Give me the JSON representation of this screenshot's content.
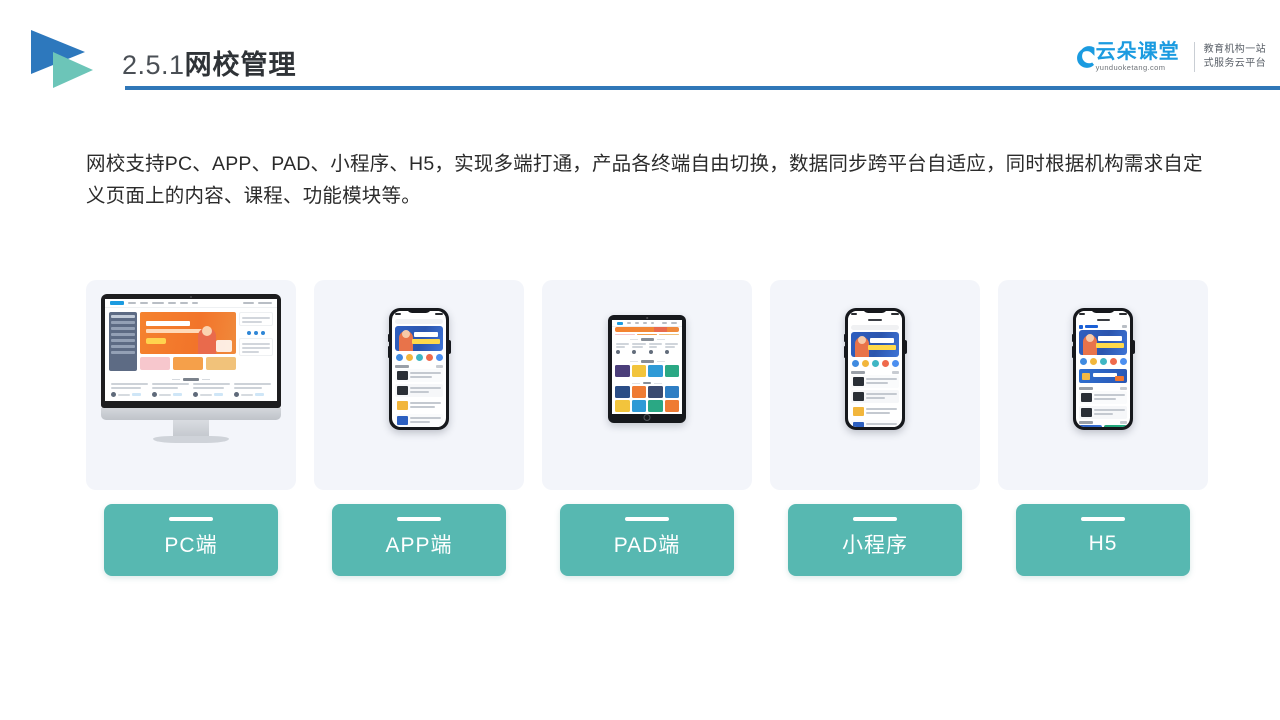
{
  "header": {
    "section_number": "2.5.1",
    "section_title": "网校管理",
    "rule_color": "#3077b8",
    "logo_triangle_colors": [
      "#2d78bd",
      "#6cc5b8"
    ]
  },
  "brand": {
    "name_cn": "云朵课堂",
    "name_en": "yunduoketang.com",
    "tagline_line1": "教育机构一站",
    "tagline_line2": "式服务云平台",
    "accent_color": "#1b9be0"
  },
  "body": {
    "paragraph": "网校支持PC、APP、PAD、小程序、H5，实现多端打通，产品各终端自由切换，数据同步跨平台自适应，同时根据机构需求自定义页面上的内容、课程、功能模块等。"
  },
  "cards": {
    "label_color": "#57b8b1",
    "card_background": "#f3f5fa",
    "items": [
      {
        "label": "PC端",
        "device": "desktop"
      },
      {
        "label": "APP端",
        "device": "phone"
      },
      {
        "label": "PAD端",
        "device": "tablet"
      },
      {
        "label": "小程序",
        "device": "phone"
      },
      {
        "label": "H5",
        "device": "phone"
      }
    ]
  }
}
